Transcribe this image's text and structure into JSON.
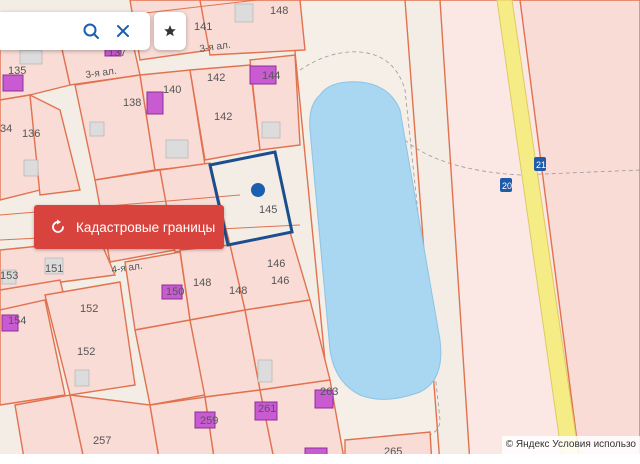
{
  "map": {
    "plots": {
      "p135": "135",
      "p137": "137",
      "p141": "141",
      "p148top": "148",
      "p136": "136",
      "p134": "34",
      "p138": "138",
      "p140": "140",
      "p142a": "142",
      "p142b": "142",
      "p144": "144",
      "p145": "145",
      "p146a": "146",
      "p146b": "146",
      "p148": "148",
      "p148b": "148",
      "p150": "150",
      "p151": "151",
      "p153": "153",
      "p152a": "152",
      "p152b": "152",
      "p154": "154",
      "p257": "257",
      "p259": "259",
      "p261": "261",
      "p263": "263",
      "p265": "265"
    },
    "streets": {
      "third_alley_a": "3-я ал.",
      "third_alley_b": "3-я ал.",
      "fourth_alley": "4-я ал."
    },
    "road_signs": [
      "21",
      "20"
    ],
    "colors": {
      "water": "#a9d6f1",
      "selected_plot_border": "#1b4e8e",
      "marker": "#1c5fb0",
      "road": "#f6ec86"
    }
  },
  "search": {
    "query": "",
    "placeholder": ""
  },
  "cadastral_button": {
    "label": "Кадастровые границы",
    "color": "#d9433d"
  },
  "copyright": {
    "text": "© Яндекс Условия использо"
  },
  "icons": [
    "search-icon",
    "close-icon",
    "star-icon",
    "refresh-icon"
  ]
}
